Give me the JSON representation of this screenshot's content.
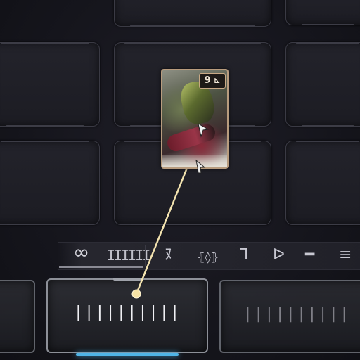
{
  "polarity_bar": {
    "capacity_symbol": "∞",
    "capacity_bars": "IIIIII",
    "polarities": [
      "ﾇ",
      "⦃◊⦄",
      "ᒣ",
      "ᐅ",
      "━",
      "≡"
    ]
  },
  "mod_card": {
    "drain": "9",
    "polarity_symbol": "⊾"
  },
  "slots": {
    "left": {
      "rank_bars": ""
    },
    "middle": {
      "rank_bars": "||||||||||"
    },
    "right": {
      "rank_bars": "||||||||||"
    }
  },
  "colors": {
    "drag_line": "#f4e4b0",
    "slot_glow": "#4fb4e6",
    "mod_border": "#b89c7e"
  }
}
